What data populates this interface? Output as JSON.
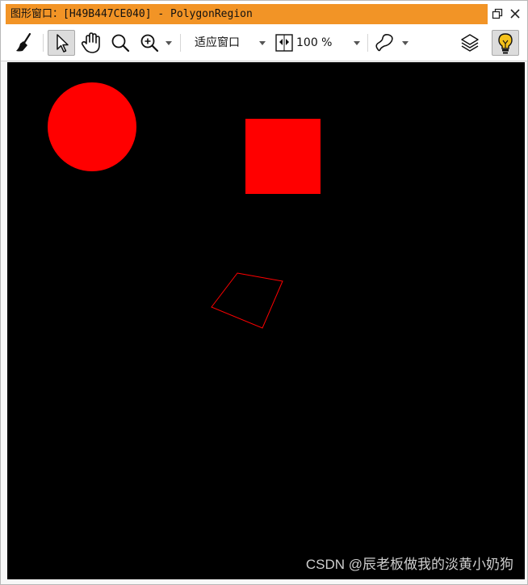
{
  "window": {
    "title": "图形窗口：[H49B447CE040] - PolygonRegion"
  },
  "toolbar": {
    "fit_window_label": "适应窗口",
    "zoom_value": "100 %"
  },
  "canvas": {
    "background": "#000000",
    "shape_color": "#ff0000"
  },
  "watermark": {
    "text": "CSDN @辰老板做我的淡黄小奶狗"
  },
  "icons": {
    "clear": "broom-icon",
    "select": "pointer-icon",
    "pan": "hand-icon",
    "zoom": "magnifier-icon",
    "zoom_in": "zoom-in-icon",
    "fit": "fit-window-icon",
    "draw": "draw-region-icon",
    "layers": "layers-icon",
    "highlight": "lightbulb-icon",
    "restore": "restore-icon",
    "close": "close-icon"
  }
}
